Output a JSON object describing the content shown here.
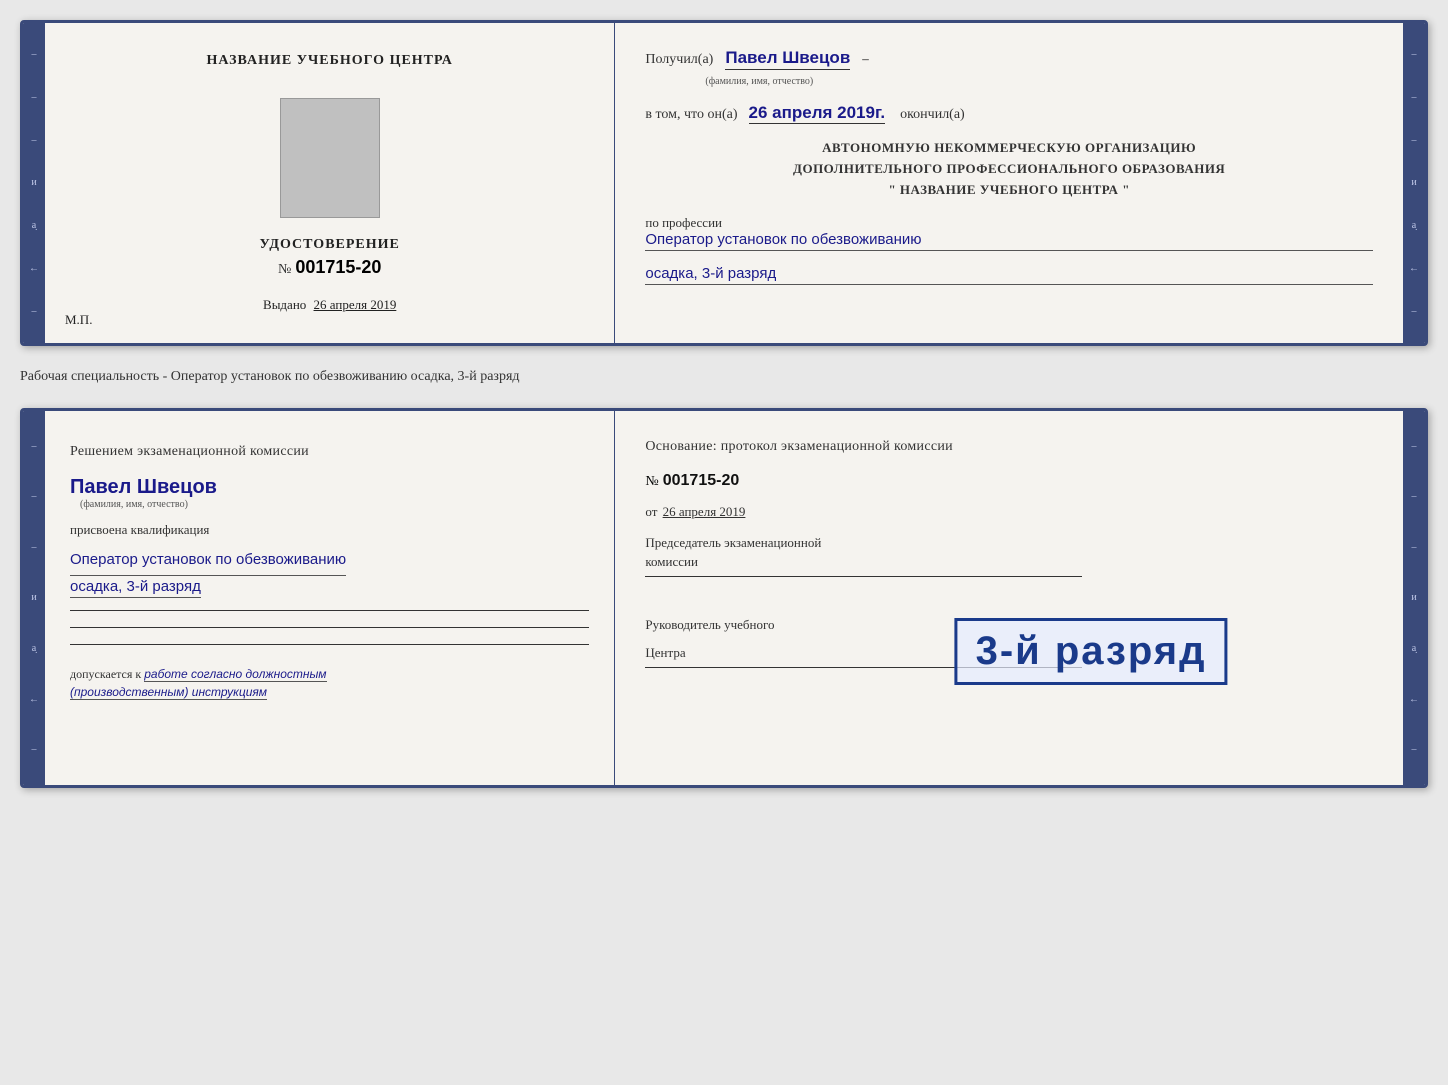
{
  "doc1": {
    "left": {
      "center_title": "НАЗВАНИЕ УЧЕБНОГО ЦЕНТРА",
      "cert_title": "УДОСТОВЕРЕНИЕ",
      "cert_number_prefix": "№",
      "cert_number": "001715-20",
      "issued_label": "Выдано",
      "issued_date": "26 апреля 2019",
      "mp_label": "М.П."
    },
    "right": {
      "received_label": "Получил(а)",
      "person_name": "Павел Швецов",
      "fio_subtitle": "(фамилия, имя, отчество)",
      "in_that_label": "в том, что он(а)",
      "date_value": "26 апреля 2019г.",
      "finished_label": "окончил(а)",
      "org_line1": "АВТОНОМНУЮ НЕКОММЕРЧЕСКУЮ ОРГАНИЗАЦИЮ",
      "org_line2": "ДОПОЛНИТЕЛЬНОГО ПРОФЕССИОНАЛЬНОГО ОБРАЗОВАНИЯ",
      "org_line3": "\"   НАЗВАНИЕ УЧЕБНОГО ЦЕНТРА   \"",
      "profession_label": "по профессии",
      "profession_value": "Оператор установок по обезвоживанию",
      "rank_value": "осадка, 3-й разряд"
    }
  },
  "middle_text": "Рабочая специальность - Оператор установок по обезвоживанию осадка, 3-й разряд",
  "doc2": {
    "left": {
      "decision_text": "Решением экзаменационной комиссии",
      "person_name": "Павел Швецов",
      "fio_subtitle": "(фамилия, имя, отчество)",
      "assigned_label": "присвоена квалификация",
      "qualification_line1": "Оператор установок по обезвоживанию",
      "qualification_line2": "осадка, 3-й разряд",
      "permitted_label": "допускается к",
      "permitted_value": "работе согласно должностным",
      "permitted_value2": "(производственным) инструкциям"
    },
    "right": {
      "basis_text": "Основание: протокол экзаменационной комиссии",
      "protocol_prefix": "№",
      "protocol_number": "001715-20",
      "date_prefix": "от",
      "date_value": "26 апреля 2019",
      "chairman_label": "Председатель экзаменационной",
      "chairman_label2": "комиссии",
      "director_label": "Руководитель учебного",
      "director_label2": "Центра"
    },
    "stamp": {
      "text": "3-й разряд"
    }
  }
}
